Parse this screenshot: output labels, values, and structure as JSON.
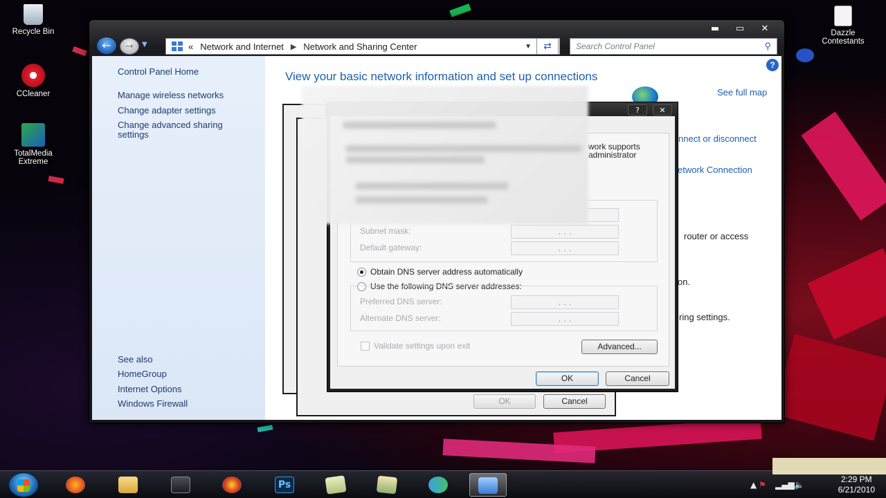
{
  "desktop": {
    "icons": [
      {
        "label": "Recycle Bin"
      },
      {
        "label": "CCleaner"
      },
      {
        "label": "TotalMedia Extreme"
      },
      {
        "label": "Dazzle Contestants"
      }
    ]
  },
  "window": {
    "caption": {
      "minimize": "▬",
      "maximize": "▭",
      "close": "✕"
    },
    "address": {
      "prefix": "«",
      "crumbs": [
        "Network and Internet",
        "Network and Sharing Center"
      ]
    },
    "search": {
      "placeholder": "Search Control Panel"
    },
    "left_pane": {
      "home": "Control Panel Home",
      "links": [
        "Manage wireless networks",
        "Change adapter settings",
        "Change advanced sharing",
        "settings"
      ],
      "see_also_heading": "See also",
      "see_also": [
        "HomeGroup",
        "Internet Options",
        "Windows Firewall"
      ]
    },
    "main": {
      "title": "View your basic network information and set up connections",
      "see_full_map": "See full map",
      "connect_disconnect": "nnect or disconnect",
      "network_connection": "etwork Connection",
      "router_text": "router or access",
      "period_text": "on.",
      "sharing_text": "ring settings."
    }
  },
  "dialog": {
    "caption_help": "?",
    "caption_close": "✕",
    "partial_text": [
      "work supports",
      "administrator"
    ],
    "subnet_label": "Subnet mask:",
    "gateway_label": "Default gateway:",
    "dns_auto_label": "Obtain DNS server address automatically",
    "dns_manual_label": "Use the following DNS server addresses:",
    "preferred_label": "Preferred DNS server:",
    "alternate_label": "Alternate DNS server:",
    "ip_dots": ". . .",
    "validate_label": "Validate settings upon exit",
    "advanced_button": "Advanced...",
    "ok_button": "OK",
    "cancel_button": "Cancel",
    "back_ok_button": "OK",
    "back_cancel_button": "Cancel"
  },
  "taskbar": {
    "clock_time": "2:29 PM",
    "clock_date": "6/21/2010"
  }
}
